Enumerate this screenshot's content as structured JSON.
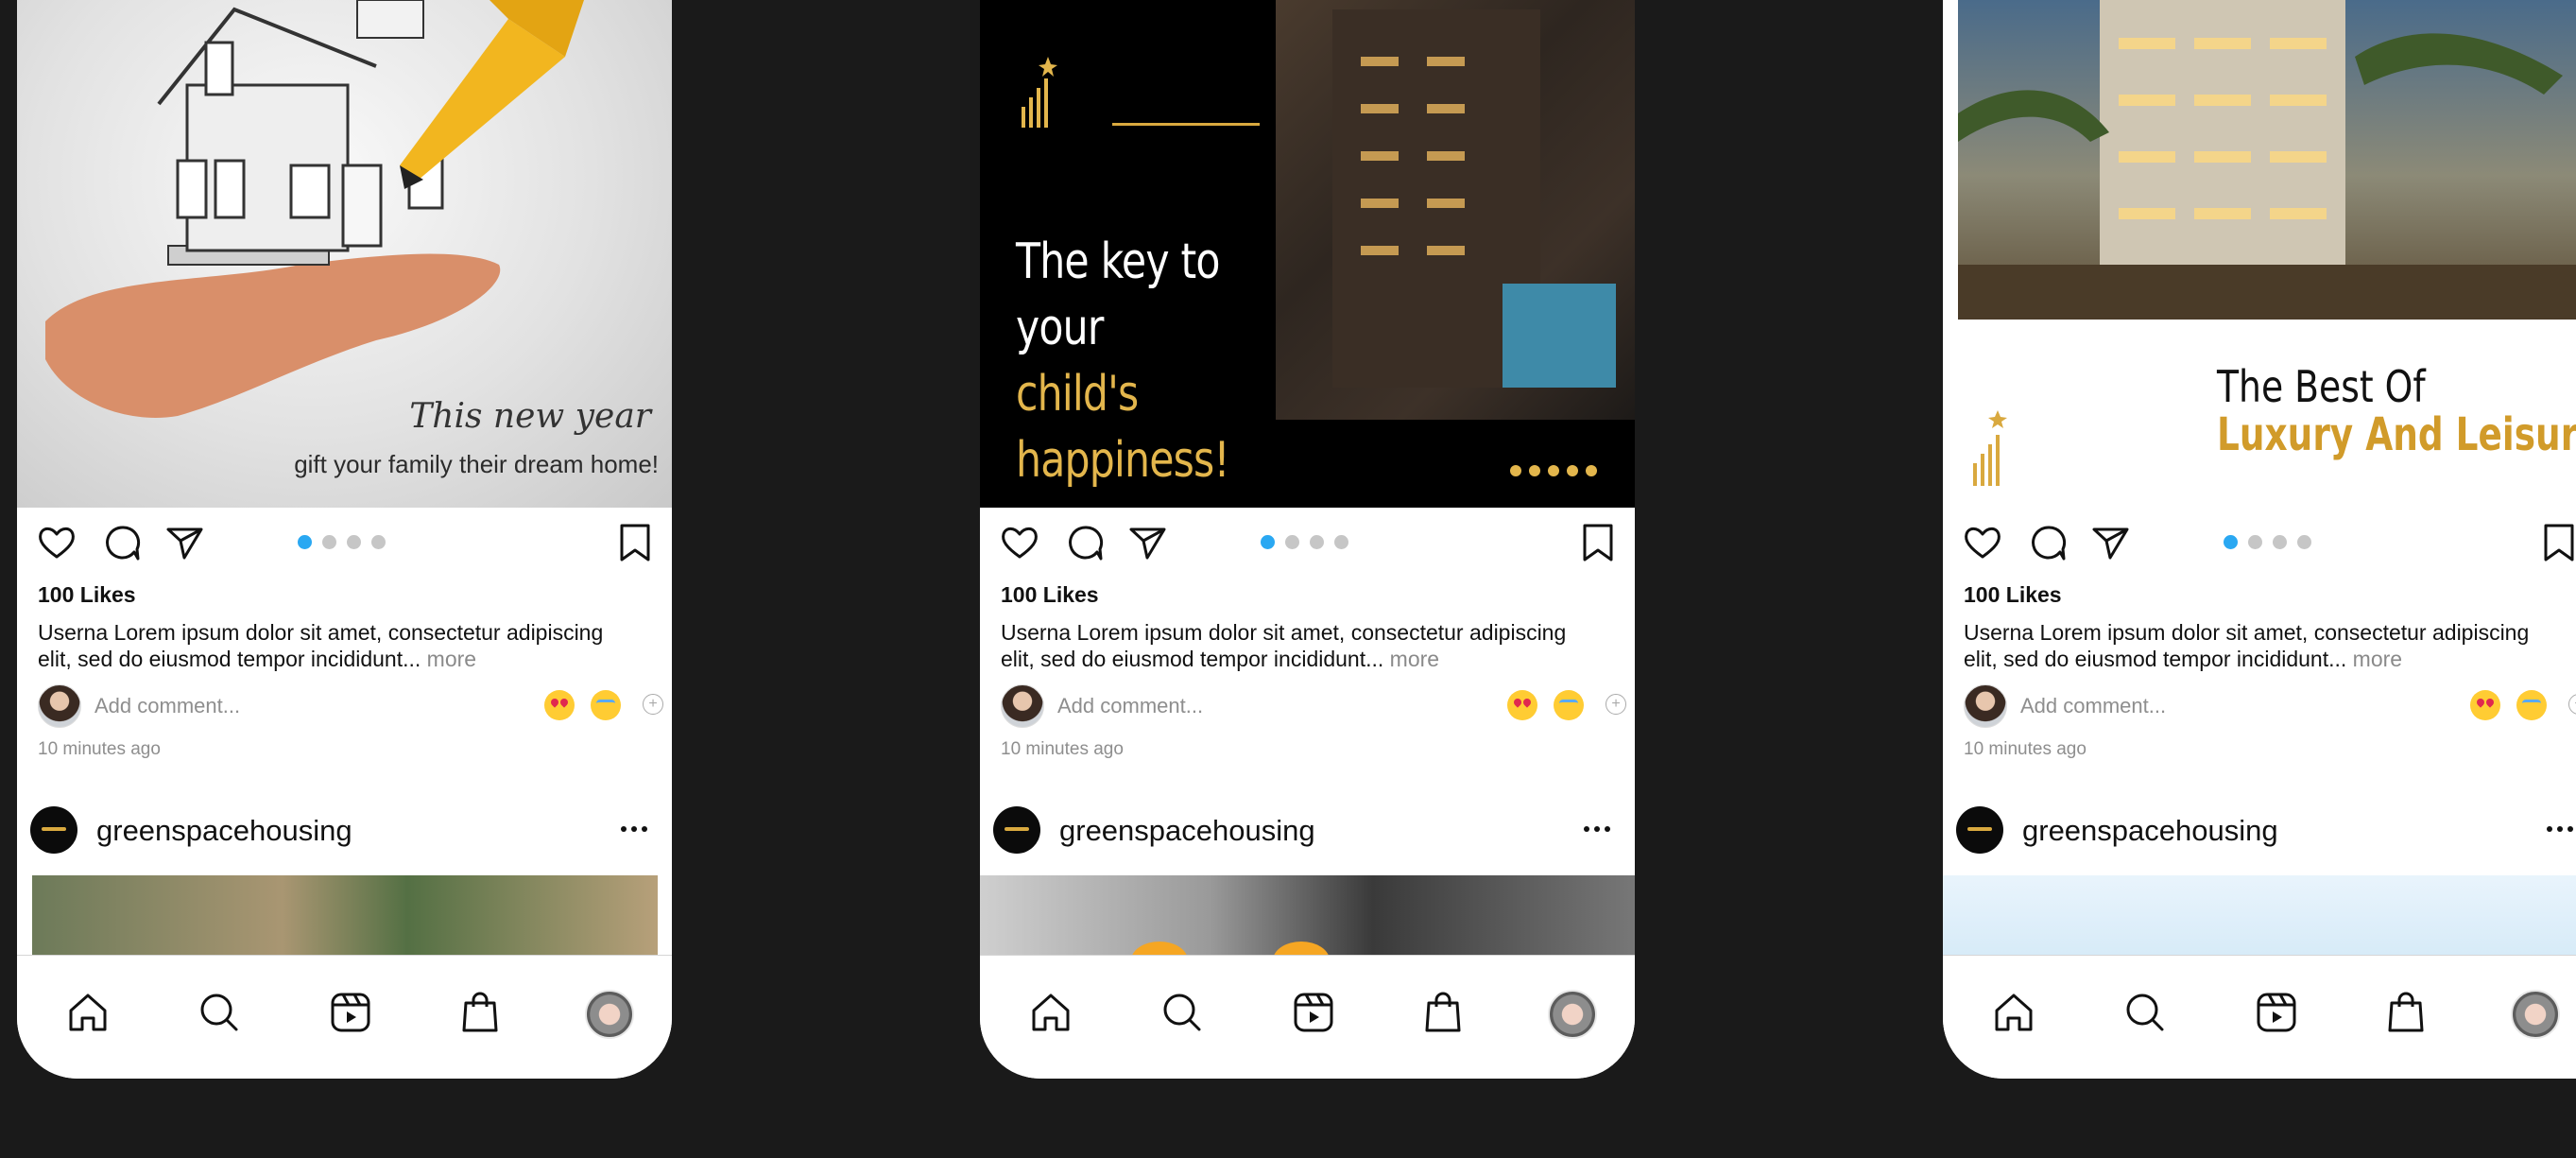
{
  "phones": [
    {
      "hero": {
        "script_text": "This new year",
        "subtitle": "gift your family their dream home!"
      },
      "likes": "100 Likes",
      "caption": "Userna Lorem ipsum dolor sit amet, consectetur adipiscing elit, sed do eiusmod tempor incididunt...",
      "more": "more",
      "add_comment": "Add comment...",
      "time": "10 minutes ago",
      "next_post_user": "greenspacehousing"
    },
    {
      "hero": {
        "title_line1": "The key to",
        "title_line2_white": "your ",
        "title_line2_gold": "child's",
        "title_line3_gold": "happiness!"
      },
      "likes": "100 Likes",
      "caption": "Userna Lorem ipsum dolor sit amet, consectetur adipiscing elit, sed do eiusmod tempor incididunt...",
      "more": "more",
      "add_comment": "Add comment...",
      "time": "10 minutes ago",
      "next_post_user": "greenspacehousing"
    },
    {
      "hero": {
        "title_line1": "The Best Of",
        "title_line2": "Luxury And Leisure!"
      },
      "likes": "100 Likes",
      "caption": "Userna Lorem ipsum dolor sit amet, consectetur adipiscing elit, sed do eiusmod tempor incididunt...",
      "more": "more",
      "add_comment": "Add comment...",
      "time": "10 minutes ago",
      "next_post_user": "greenspacehousing"
    }
  ],
  "carousel": {
    "count": 4,
    "active_index": 0
  },
  "icons": [
    "heart-icon",
    "comment-icon",
    "share-icon",
    "bookmark-icon",
    "home-icon",
    "search-icon",
    "reels-icon",
    "shop-icon",
    "profile-avatar"
  ],
  "colors": {
    "background": "#1a1a1a",
    "gold": "#e3b64c",
    "active_dot": "#2aa8f2"
  }
}
